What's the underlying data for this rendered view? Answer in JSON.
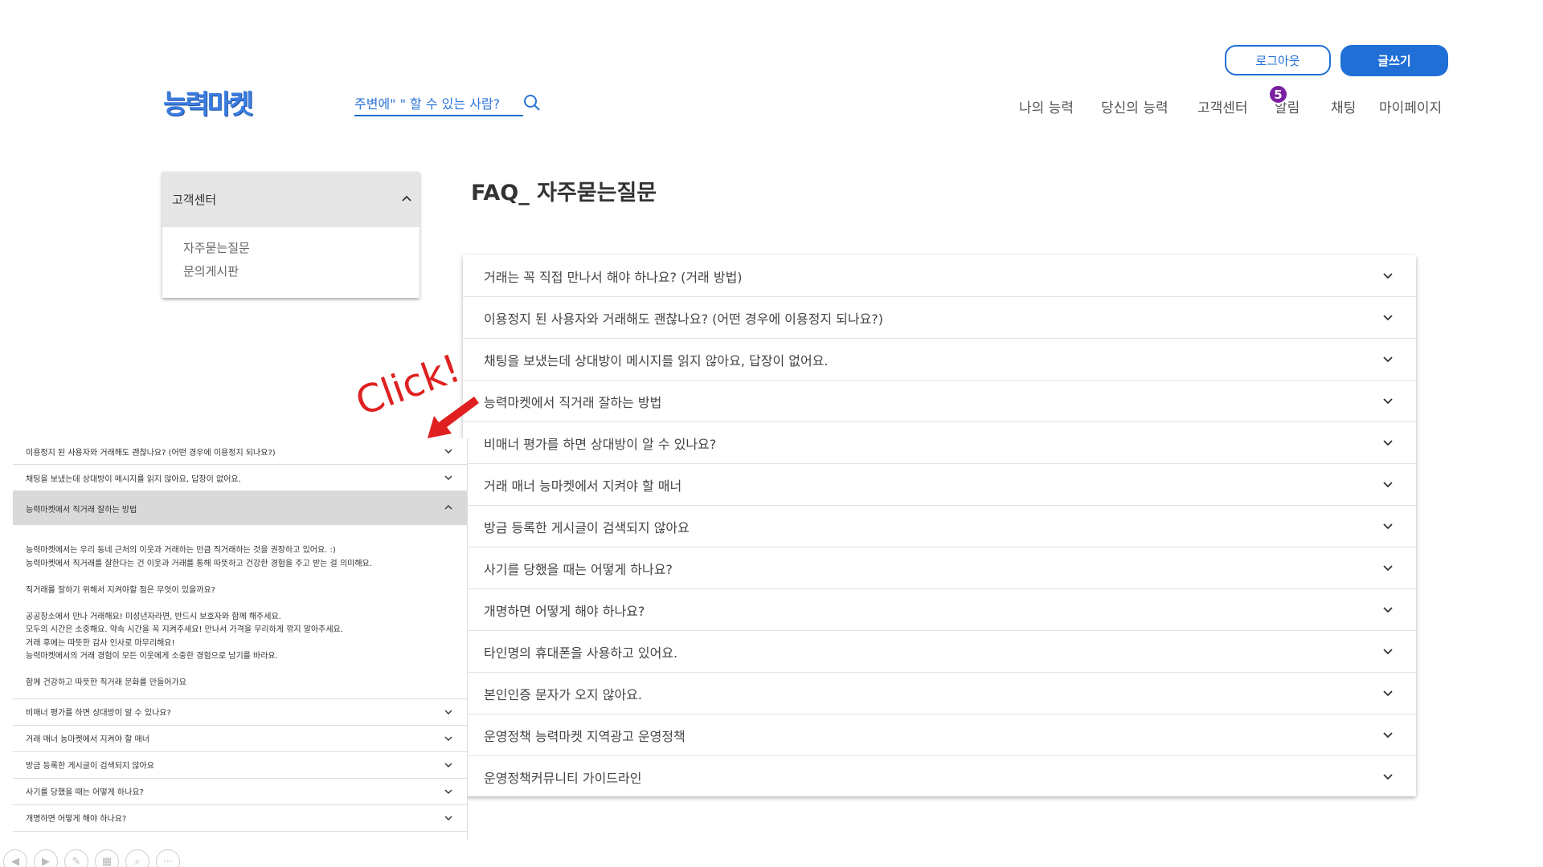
{
  "header": {
    "logo": "능력마켓",
    "search_placeholder": "주변에\" \" 할 수 있는 사람?",
    "logout_label": "로그아웃",
    "write_label": "글쓰기",
    "nav": [
      "나의 능력",
      "당신의 능력",
      "고객센터",
      "알림",
      "채팅",
      "마이페이지"
    ],
    "notification_count": "5"
  },
  "sidebar": {
    "title": "고객센터",
    "items": [
      "자주묻는질문",
      "문의게시판"
    ]
  },
  "page_title": "FAQ_ 자주묻는질문",
  "faq": [
    "거래는 꼭 직접 만나서 해야 하나요? (거래 방법)",
    "이용정지 된 사용자와 거래해도 괜찮나요? (어떤 경우에 이용정지 되나요?)",
    "채팅을 보냈는데 상대방이 메시지를 읽지 않아요, 답장이 없어요.",
    "능력마켓에서 직거래 잘하는 방법",
    "비매너 평가를 하면 상대방이 알 수 있나요?",
    "거래 매너 능마켓에서 지켜야 할 매너",
    "방금 등록한 게시글이 검색되지 않아요",
    "사기를 당했을 때는 어떻게 하나요?",
    "개명하면 어떻게 해야 하나요?",
    "타인명의 휴대폰을 사용하고 있어요.",
    "본인인증 문자가 오지 않아요.",
    "운영정책 능력마켓 지역광고 운영정책",
    "운영정책커뮤니티 가이드라인"
  ],
  "annotation": {
    "click_text": "Click!",
    "color": "#e02020"
  },
  "zoom": {
    "items_before": [
      "이용정지 된 사용자와 거래해도 괜찮나요? (어떤 경우에 이용정지 되나요?)",
      "채팅을 보냈는데 상대방이 메시지를 읽지 않아요, 답장이 없어요."
    ],
    "open_item": "능력마켓에서 직거래 잘하는 방법",
    "answer": {
      "p1_l1": "능력마켓에서는 우리 동네 근처의 이웃과 거래하는 만큼 직거래하는 것을 권장하고 있어요. :)",
      "p1_l2": "능력마켓에서 직거래를 잘한다는 건 이웃과 거래를 통해 따뜻하고 건강한 경험을 주고 받는 걸 의미해요.",
      "p2": "직거래를 잘하기 위해서 지켜야할 점은 무엇이 있을까요?",
      "p3_l1": "공공장소에서 만나 거래해요! 미성년자라면, 반드시 보호자와 함께 해주세요.",
      "p3_l2": "모두의 시간은 소중해요. 약속 시간을 꼭 지켜주세요! 만나서 가격을 무리하게 깎지 말아주세요.",
      "p3_l3": "거래 후에는 따뜻한 감사 인사로 마무리해요!",
      "p3_l4": "능력마켓에서의 거래 경험이 모든 이웃에게 소중한 경험으로 남기를 바라요.",
      "p4": "함께 건강하고 따뜻한 직거래 문화를 만들어가요"
    },
    "items_after": [
      "비매너 평가를 하면 상대방이 알 수 있나요?",
      "거래 매너 능마켓에서 지켜야 할 매너",
      "방금 등록한 게시글이 검색되지 않아요",
      "사기를 당했을 때는 어떻게 하나요?",
      "개명하면 어떻게 해야 하나요?"
    ]
  },
  "colors": {
    "primary": "#1f6fd6",
    "badge": "#7a1fa2"
  }
}
